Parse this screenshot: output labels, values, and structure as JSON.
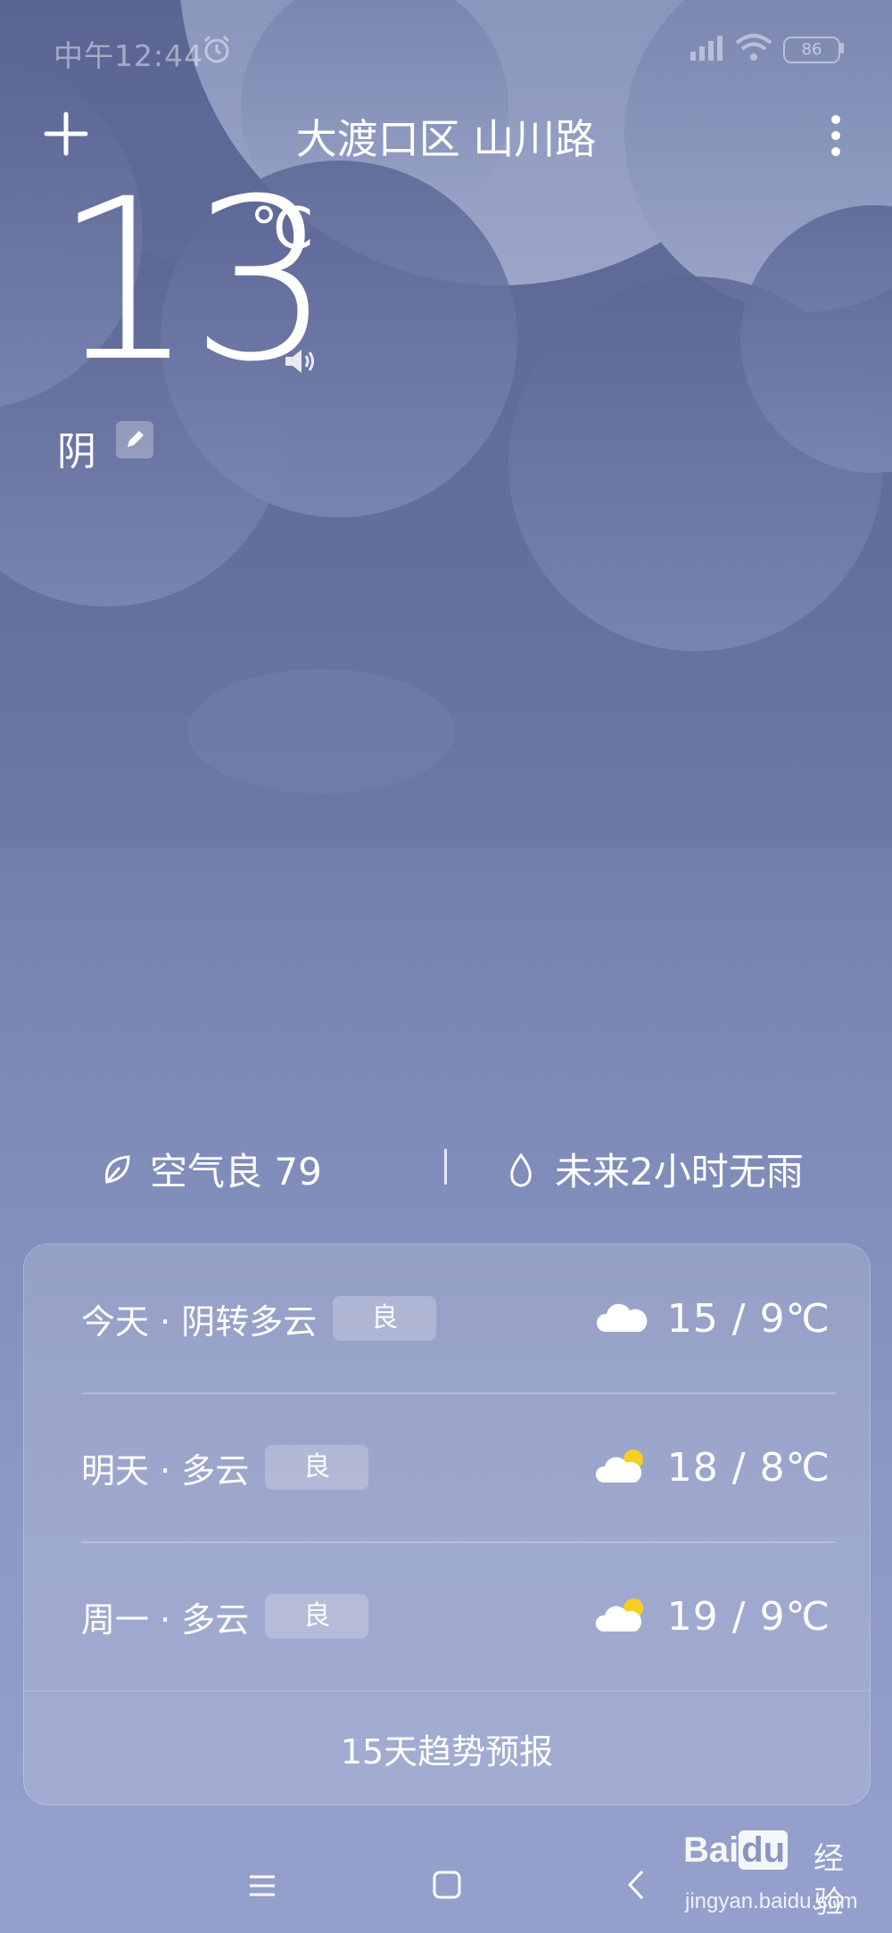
{
  "status_bar": {
    "time": "中午12:44",
    "battery": "86"
  },
  "header": {
    "location": "大渡口区 山川路"
  },
  "current": {
    "temperature": "13",
    "unit": "℃",
    "condition": "阴"
  },
  "summary": {
    "air": "空气良 79",
    "rain": "未来2小时无雨"
  },
  "forecast": {
    "days": [
      {
        "label": "今天 · 阴转多云",
        "aqi": "良",
        "temps": "15 / 9℃",
        "icon": "cloudy-icon"
      },
      {
        "label": "明天 · 多云",
        "aqi": "良",
        "temps": "18 / 8℃",
        "icon": "partly-cloudy-icon"
      },
      {
        "label": "周一 · 多云",
        "aqi": "良",
        "temps": "19 / 9℃",
        "icon": "partly-cloudy-icon"
      }
    ],
    "footer": "15天趋势预报"
  },
  "watermark": {
    "brand": "Bai",
    "brand_du": "du",
    "brand_cn": "经验",
    "url": "jingyan.baidu.com"
  },
  "colors": {
    "background_top": "#5a6594",
    "background_bottom": "#95a1cc",
    "sun": "#f5d020"
  }
}
